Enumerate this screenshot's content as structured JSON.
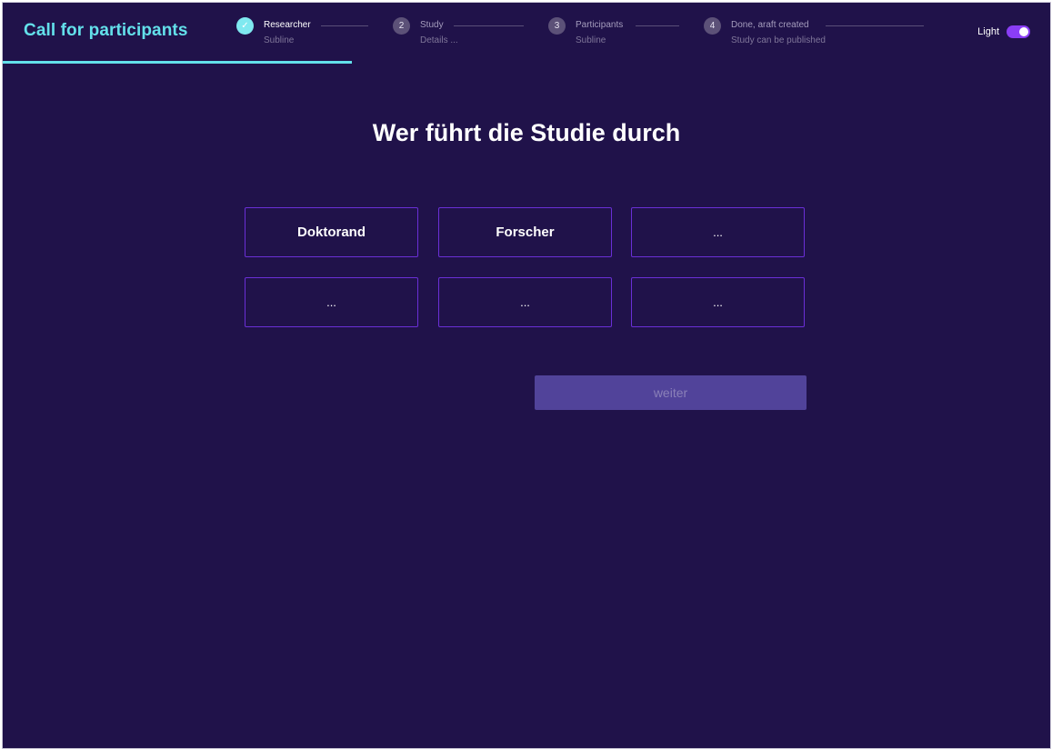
{
  "header": {
    "app_title": "Call for participants",
    "steps": [
      {
        "number": "✓",
        "title": "Researcher",
        "subtitle": "Subline",
        "state": "done"
      },
      {
        "number": "2",
        "title": "Study",
        "subtitle": "Details ...",
        "state": "pending"
      },
      {
        "number": "3",
        "title": "Participants",
        "subtitle": "Subline",
        "state": "pending"
      },
      {
        "number": "4",
        "title": "Done, araft created",
        "subtitle": "Study can be published",
        "state": "pending"
      }
    ],
    "theme_toggle": {
      "label": "Light",
      "on": true
    },
    "progress": 0.33
  },
  "main": {
    "title": "Wer führt die Studie durch",
    "options": [
      "Doktorand",
      "Forscher",
      "...",
      "...",
      "...",
      "..."
    ],
    "next_label": "weiter"
  },
  "colors": {
    "background": "#20124a",
    "accent_cyan": "#63e0ea",
    "option_border": "#6a2fd6",
    "toggle": "#8a3df5",
    "button": "#51439a"
  }
}
